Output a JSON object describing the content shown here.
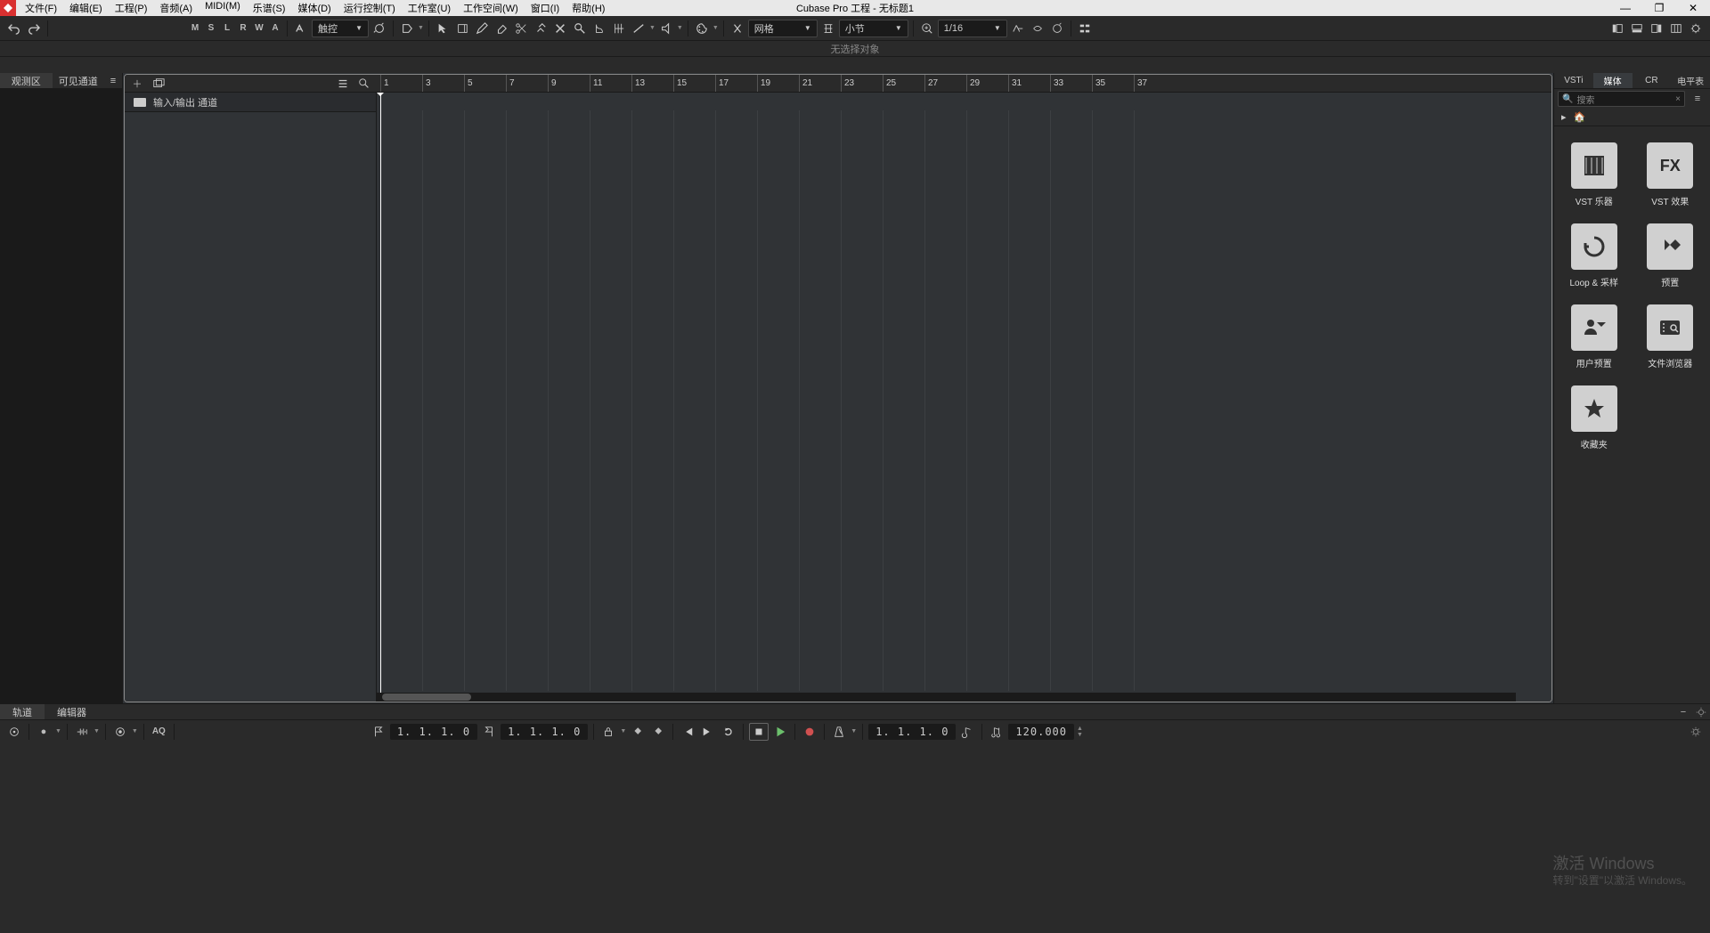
{
  "title": "Cubase Pro 工程 - 无标题1",
  "menu": [
    "文件(F)",
    "编辑(E)",
    "工程(P)",
    "音频(A)",
    "MIDI(M)",
    "乐谱(S)",
    "媒体(D)",
    "运行控制(T)",
    "工作室(U)",
    "工作空间(W)",
    "窗口(I)",
    "帮助(H)"
  ],
  "toolbar": {
    "state_btns": [
      "M",
      "S",
      "L",
      "R",
      "W",
      "A"
    ],
    "automation_mode": "触控",
    "snap_type": "网格",
    "grid_type": "小节",
    "quantize": "1/16"
  },
  "info_line": "无选择对象",
  "left_tabs": {
    "inspector": "观测区",
    "visibility": "可见通道"
  },
  "track": {
    "io_folder": "输入/输出 通道"
  },
  "ruler_marks": [
    1,
    3,
    5,
    7,
    9,
    11,
    13,
    15,
    17,
    19,
    21,
    23,
    25,
    27,
    29,
    31,
    33,
    35,
    37
  ],
  "right": {
    "tabs": [
      "VSTi",
      "媒体",
      "CR",
      "电平表"
    ],
    "active_tab": "媒体",
    "search_placeholder": "搜索",
    "items": [
      {
        "label": "VST 乐器",
        "icon": "piano"
      },
      {
        "label": "VST 效果",
        "icon": "fx"
      },
      {
        "label": "Loop & 采样",
        "icon": "loop"
      },
      {
        "label": "预置",
        "icon": "preset"
      },
      {
        "label": "用户预置",
        "icon": "user"
      },
      {
        "label": "文件浏览器",
        "icon": "browser"
      },
      {
        "label": "收藏夹",
        "icon": "star"
      }
    ]
  },
  "bottom_tabs": {
    "tracks": "轨道",
    "editor": "编辑器"
  },
  "transport": {
    "aq": "AQ",
    "left_locator": "1.  1.  1.    0",
    "right_locator": "1.  1.  1.    0",
    "position": "1.  1.  1.    0",
    "tempo": "120.000"
  },
  "watermark": {
    "line1": "激活 Windows",
    "line2": "转到\"设置\"以激活 Windows。"
  }
}
